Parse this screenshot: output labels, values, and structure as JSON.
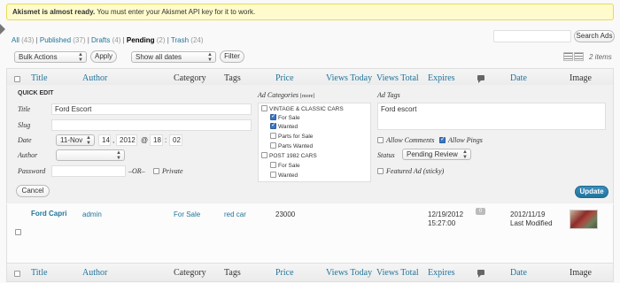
{
  "notice": {
    "bold": "Akismet is almost ready.",
    "text": " You must enter your Akismet API key for it to work."
  },
  "views": [
    {
      "label": "All",
      "count": "(43)"
    },
    {
      "label": "Published",
      "count": "(37)"
    },
    {
      "label": "Drafts",
      "count": "(4)"
    },
    {
      "label": "Pending",
      "count": "(2)",
      "current": true
    },
    {
      "label": "Trash",
      "count": "(24)"
    }
  ],
  "search": {
    "button": "Search Ads"
  },
  "toolbar": {
    "bulk_actions": "Bulk Actions",
    "apply": "Apply",
    "dates": "Show all dates",
    "filter": "Filter",
    "items": "2 items"
  },
  "columns": {
    "title": "Title",
    "author": "Author",
    "category": "Category",
    "tags": "Tags",
    "price": "Price",
    "views_today": "Views Today",
    "views_total": "Views Total",
    "expires": "Expires",
    "date": "Date",
    "image": "Image"
  },
  "quick_edit": {
    "heading": "QUICK EDIT",
    "title_label": "Title",
    "title_value": "Ford Escort",
    "slug_label": "Slug",
    "slug_value": "",
    "date_label": "Date",
    "month": "11-Nov",
    "day": "14",
    "year": "2012",
    "hour": "18",
    "minute": "02",
    "author_label": "Author",
    "password_label": "Password",
    "or": "–OR–",
    "private_label": "Private",
    "ad_categories_label": "Ad Categories",
    "more": "[more]",
    "categories": [
      {
        "label": "VINTAGE & CLASSIC CARS",
        "checked": false,
        "level": 0
      },
      {
        "label": "For Sale",
        "checked": true,
        "level": 1
      },
      {
        "label": "Wanted",
        "checked": true,
        "level": 1
      },
      {
        "label": "Parts for Sale",
        "checked": false,
        "level": 1
      },
      {
        "label": "Parts Wanted",
        "checked": false,
        "level": 1
      },
      {
        "label": "POST 1982 CARS",
        "checked": false,
        "level": 0
      },
      {
        "label": "For Sale",
        "checked": false,
        "level": 1
      },
      {
        "label": "Wanted",
        "checked": false,
        "level": 1
      }
    ],
    "ad_tags_label": "Ad Tags",
    "ad_tags_value": "Ford escort",
    "allow_comments": "Allow Comments",
    "allow_pings": "Allow Pings",
    "status_label": "Status",
    "status_value": "Pending Review",
    "featured": "Featured Ad (sticky)",
    "cancel": "Cancel",
    "update": "Update"
  },
  "row": {
    "title": "Ford Capri",
    "author": "admin",
    "category": "For Sale",
    "tags": "red car",
    "price": "23000",
    "comments": "0",
    "expires_date": "12/19/2012",
    "expires_time": "15:27:00",
    "date": "2012/11/19",
    "date_status": "Last Modified"
  }
}
